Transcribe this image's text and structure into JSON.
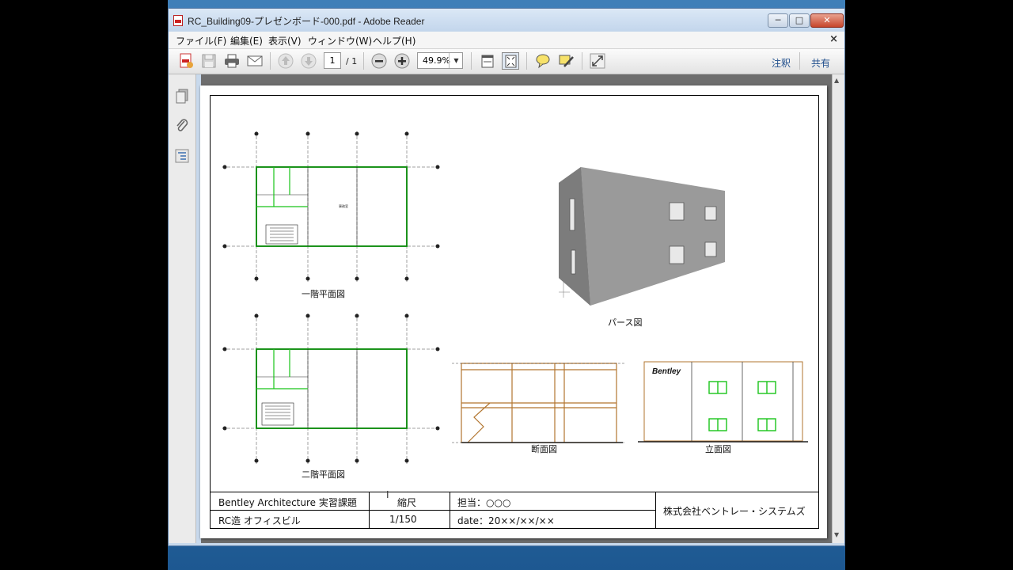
{
  "window": {
    "title": "RC_Building09-プレゼンボード-000.pdf - Adobe Reader",
    "minimize": "─",
    "maximize": "□",
    "close": "✕"
  },
  "menu": {
    "items": [
      "ファイル(F)",
      "編集(E)",
      "表示(V)",
      "ウィンドウ(W)",
      "ヘルプ(H)"
    ],
    "close": "×"
  },
  "toolbar": {
    "page_current": "1",
    "page_total": "/ 1",
    "zoom": "49.9%",
    "comment_label": "注釈",
    "share_label": "共有"
  },
  "drawing": {
    "plan1_caption": "一階平面図",
    "plan2_caption": "二階平面図",
    "perspective_caption": "パース図",
    "section_caption": "断面図",
    "elevation_caption": "立面図",
    "elevation_logo": "Bentley",
    "plan_hall_label": "事務室"
  },
  "titleblock": {
    "project": "Bentley Architecture 実習課題",
    "building": "RC造 オフィスビル",
    "scale_label": "縮尺",
    "scale_value": "1/150",
    "owner": "担当：○○○",
    "date": "date：20××/××/××",
    "company": "株式会社ベントレー・システムズ"
  },
  "colors": {
    "wall_green": "#19c419",
    "section_brown": "#b2752f",
    "model_grey": "#8a8a8a"
  }
}
